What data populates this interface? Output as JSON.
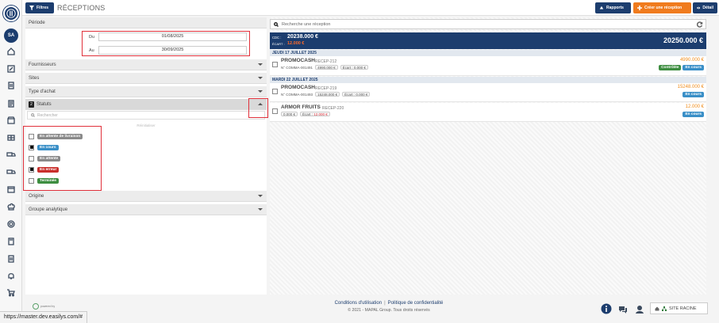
{
  "user": {
    "initials": "SA"
  },
  "topbar": {
    "filter_label": "Filtres",
    "title": "RÉCEPTIONS",
    "rapports_label": "Rapports",
    "create_label": "Créer une réception",
    "detail_label": "Détail"
  },
  "filters": {
    "periode_label": "Période",
    "du_label": "Du",
    "du_value": "01/08/2025",
    "au_label": "Au",
    "au_value": "30/09/2025",
    "fournisseurs_label": "Fournisseurs",
    "sites_label": "Sites",
    "type_label": "Type d'achat",
    "statuts_count": "2",
    "statuts_label": "Statuts",
    "search_placeholder": "Rechercher",
    "reinit_label": "Réinitialiser",
    "statuses": [
      {
        "label": "En attente de livraison",
        "checked": false,
        "color": "#8a8a8a"
      },
      {
        "label": "En cours",
        "checked": true,
        "color": "#3a8fc7"
      },
      {
        "label": "En attente",
        "checked": false,
        "color": "#8a8a8a"
      },
      {
        "label": "En erreur",
        "checked": true,
        "color": "#c9302c"
      },
      {
        "label": "Terminée",
        "checked": false,
        "color": "#3e8e41"
      }
    ],
    "origine_label": "Origine",
    "groupe_label": "Groupe analytique",
    "powered_label": "powered by"
  },
  "list": {
    "search_placeholder": "Recherche une réception",
    "summary": {
      "cdc_label": "CDC :",
      "cdc_value": "20238.000 €",
      "ecart_label": "ÉCART :",
      "ecart_value": "12.000 €",
      "total": "20250.000 €"
    },
    "days": [
      {
        "label": "JEUDI 17 JUILLET 2025"
      },
      {
        "label": "MARDI 22 JUILLET 2025"
      }
    ],
    "receptions": [
      {
        "supplier": "PROMOCASH",
        "ref": "RECEP-212",
        "commande": "N° COMMA-001491",
        "cmd_amount": "4990.000 €",
        "ecart_label": "Écart :",
        "ecart_value": "0.000 €",
        "amount": "4990.000 €",
        "tags": [
          {
            "label": "Contrôlée",
            "color": "#3e8e41"
          },
          {
            "label": "En cours",
            "color": "#3a8fc7"
          }
        ]
      },
      {
        "supplier": "PROMOCASH",
        "ref": "RECEP-219",
        "commande": "N° COMMA-001493",
        "cmd_amount": "15248.000 €",
        "ecart_label": "Écart :",
        "ecart_value": "0.000 €",
        "amount": "15248.000 €",
        "tags": [
          {
            "label": "En cours",
            "color": "#3a8fc7"
          }
        ]
      },
      {
        "supplier": "ARMOR FRUITS",
        "ref": "RECEP-220",
        "cmd_amount": "0.000 €",
        "ecart_label": "Écart :",
        "ecart_value": "12.000 €",
        "amount": "12.000 €",
        "tags": [
          {
            "label": "En cours",
            "color": "#3a8fc7"
          }
        ]
      }
    ]
  },
  "footer": {
    "conditions": "Conditions d'utilisation",
    "separator": "|",
    "privacy": "Politique de confidentialité",
    "copyright": "© 2021 - MAPAL Group. Tous droits réservés",
    "site_label": "SITE RACINE"
  },
  "statusbar": {
    "url": "https://master.dev.easilys.com/#"
  }
}
